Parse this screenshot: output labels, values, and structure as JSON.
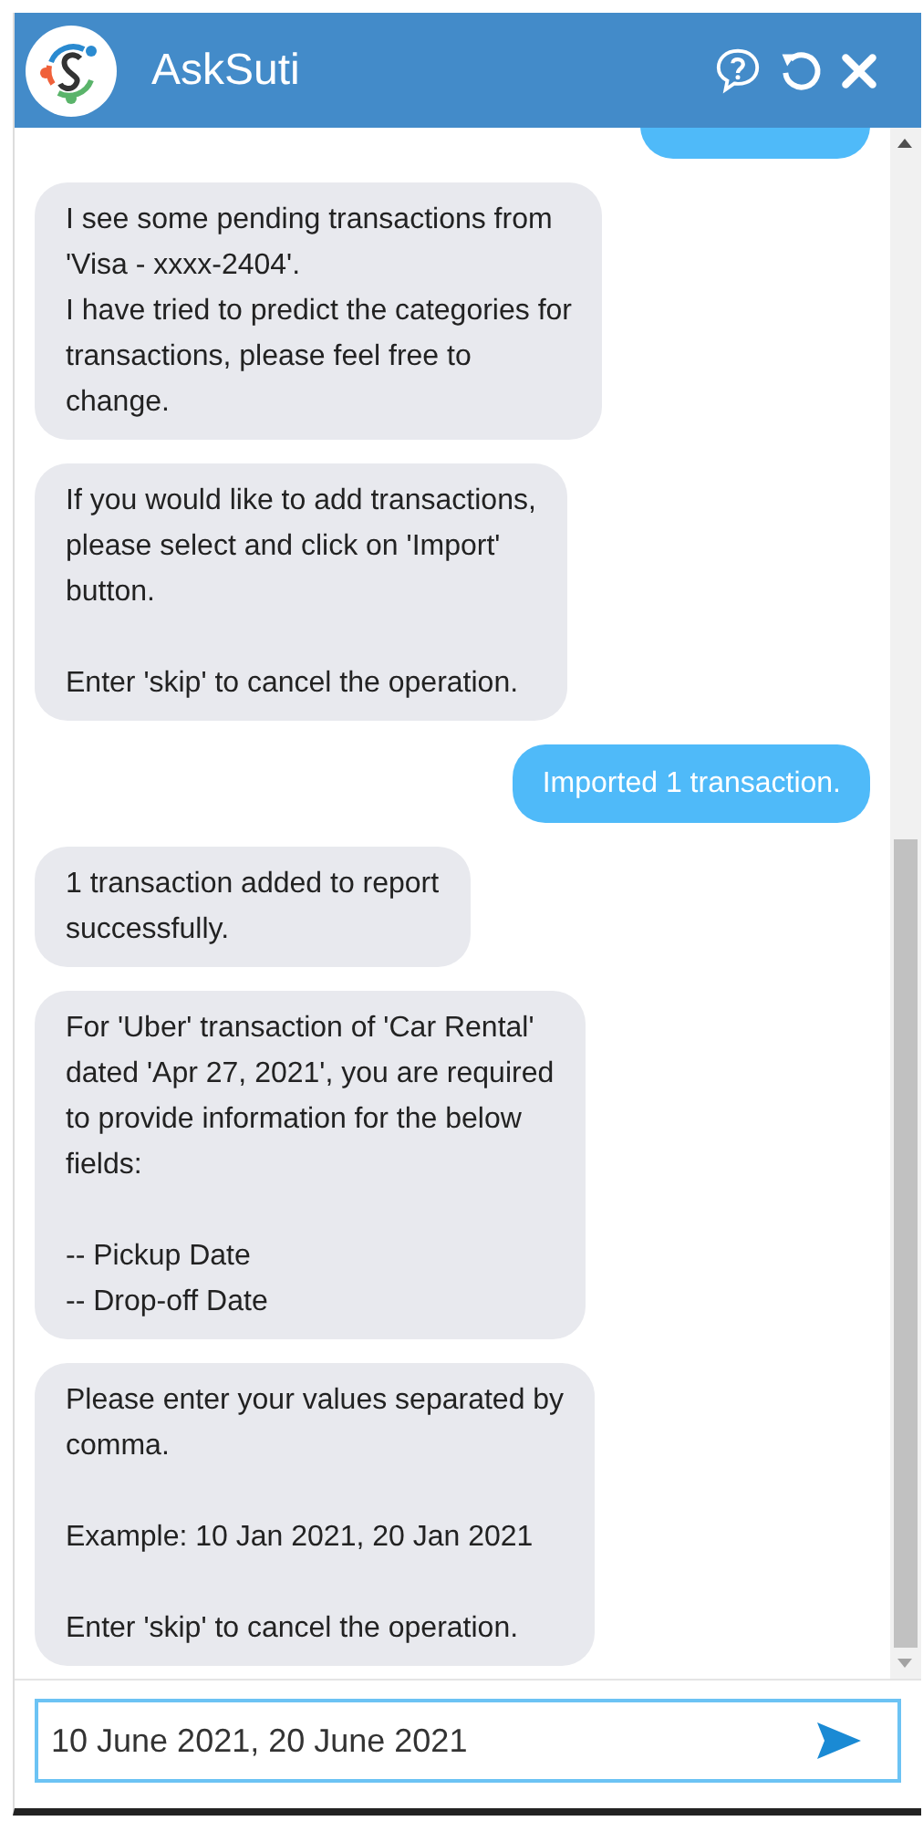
{
  "header": {
    "title": "AskSuti"
  },
  "messages": [
    {
      "kind": "user-cut"
    },
    {
      "kind": "bot",
      "text": "I see some pending transactions from\n'Visa - xxxx-2404'.\nI have tried to predict the categories for\ntransactions, please feel free to\nchange."
    },
    {
      "kind": "bot",
      "text": "If you would like to add transactions,\nplease select and click on 'Import'\nbutton.\n\nEnter 'skip' to cancel the operation."
    },
    {
      "kind": "user",
      "text": "Imported 1 transaction."
    },
    {
      "kind": "bot",
      "text": "1 transaction added to report\nsuccessfully."
    },
    {
      "kind": "bot",
      "text": "For 'Uber' transaction of 'Car Rental'\ndated 'Apr 27, 2021', you are required\nto provide information for the below\nfields:\n\n-- Pickup Date\n-- Drop-off Date"
    },
    {
      "kind": "bot",
      "text": "Please enter your values separated by\ncomma.\n\nExample: 10 Jan 2021, 20 Jan 2021\n\nEnter 'skip' to cancel the operation."
    }
  ],
  "input": {
    "value": "10 June 2021, 20 June 2021"
  }
}
